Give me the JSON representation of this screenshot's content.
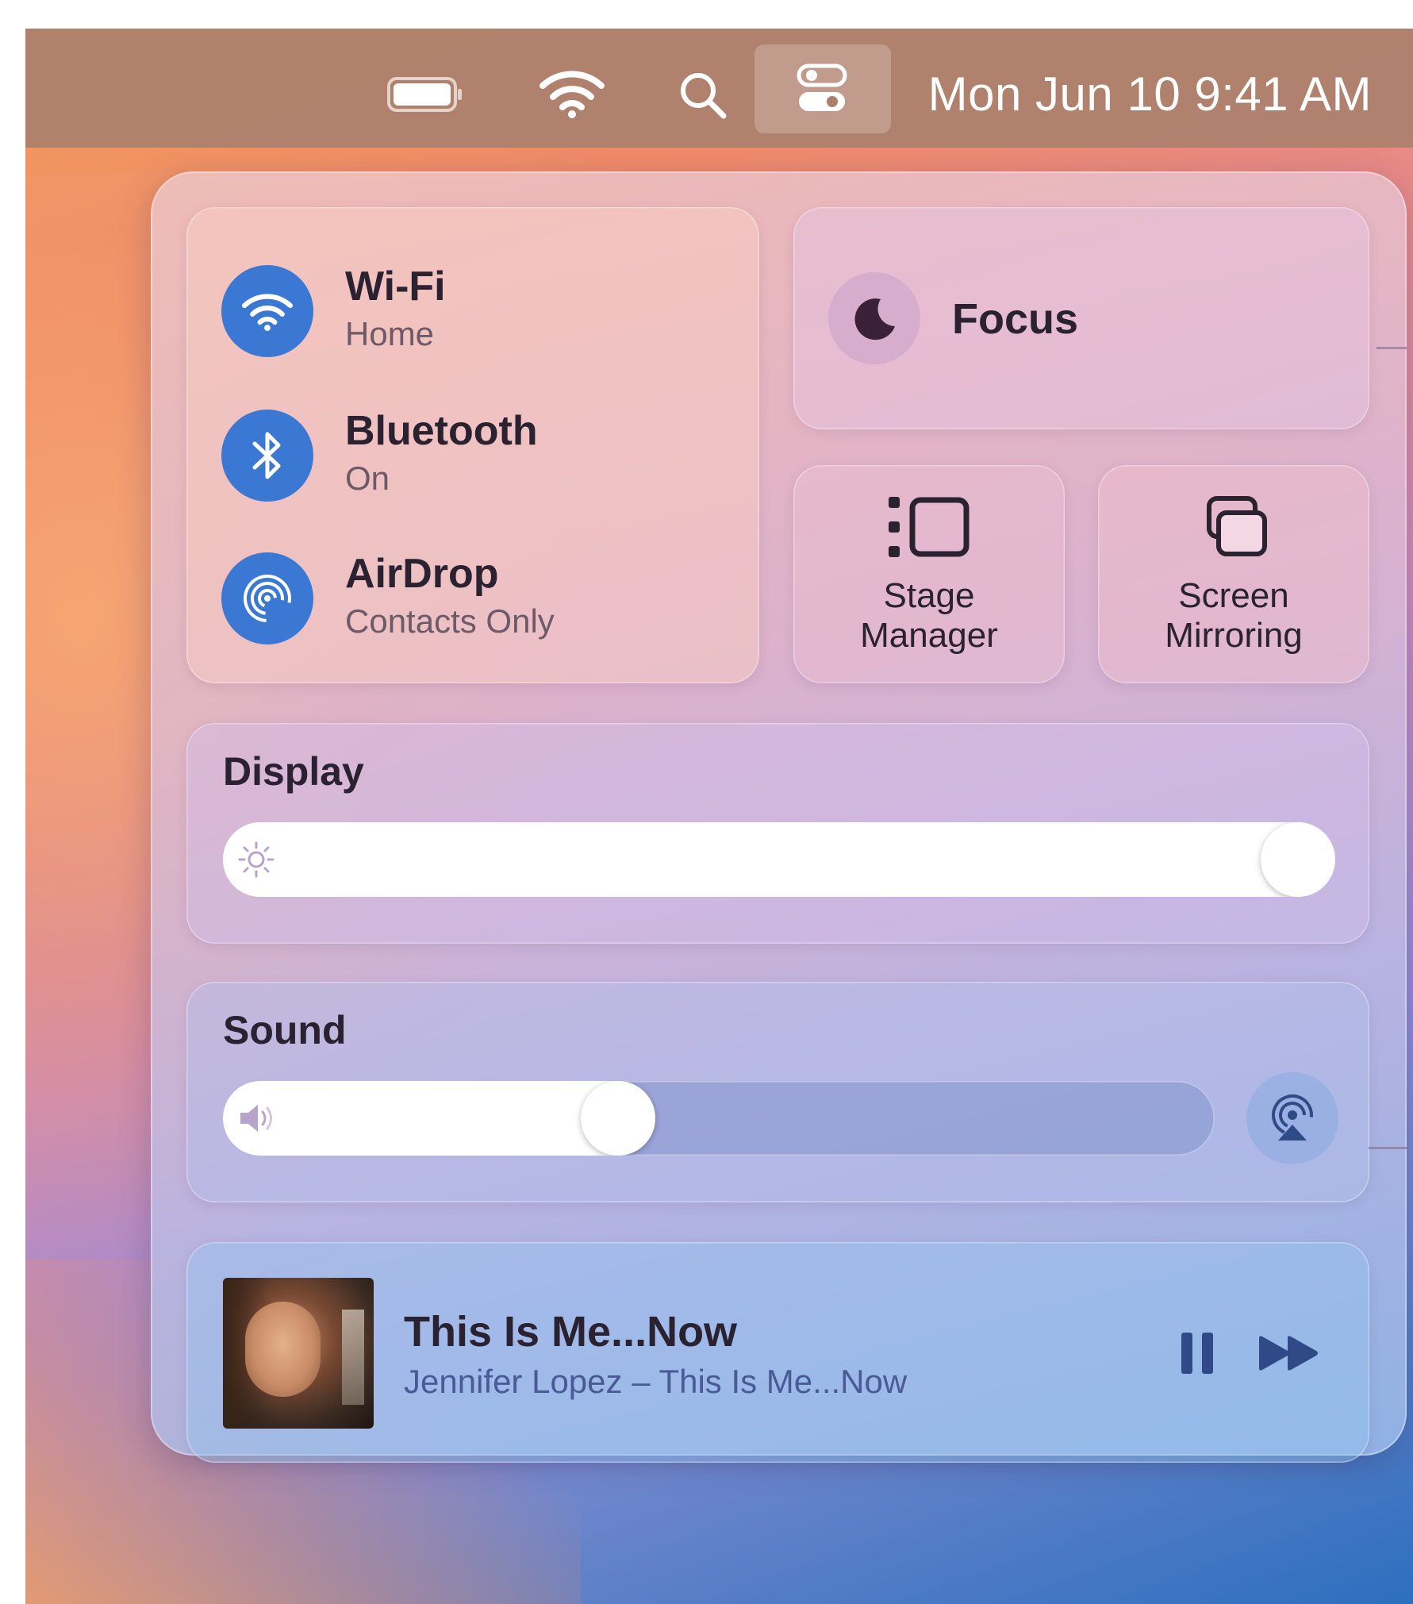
{
  "menubar": {
    "battery_icon": "battery-icon",
    "wifi_icon": "wifi-icon",
    "search_icon": "search-icon",
    "control_center_icon": "control-center-icon",
    "clock": "Mon Jun 10  9:41 AM"
  },
  "control_center": {
    "connectivity": [
      {
        "title": "Wi-Fi",
        "subtitle": "Home",
        "icon": "wifi-icon"
      },
      {
        "title": "Bluetooth",
        "subtitle": "On",
        "icon": "bluetooth-icon"
      },
      {
        "title": "AirDrop",
        "subtitle": "Contacts Only",
        "icon": "airdrop-icon"
      }
    ],
    "focus": {
      "label": "Focus",
      "icon": "moon-icon"
    },
    "stage_manager": {
      "label": "Stage\nManager",
      "icon": "stage-manager-icon"
    },
    "screen_mirroring": {
      "label": "Screen\nMirroring",
      "icon": "screen-mirroring-icon"
    },
    "display": {
      "title": "Display",
      "brightness": 1.0,
      "icon": "sun-icon"
    },
    "sound": {
      "title": "Sound",
      "volume": 0.39,
      "icon": "speaker-icon",
      "airplay_icon": "airplay-audio-icon"
    },
    "now_playing": {
      "title": "This Is Me...Now",
      "subtitle": "Jennifer Lopez – This Is Me...Now",
      "pause_icon": "pause-icon",
      "forward_icon": "forward-icon"
    }
  },
  "colors": {
    "accent_blue": "#3b78d3",
    "menubar": "#aa806c",
    "text_dark": "#2a2230"
  }
}
